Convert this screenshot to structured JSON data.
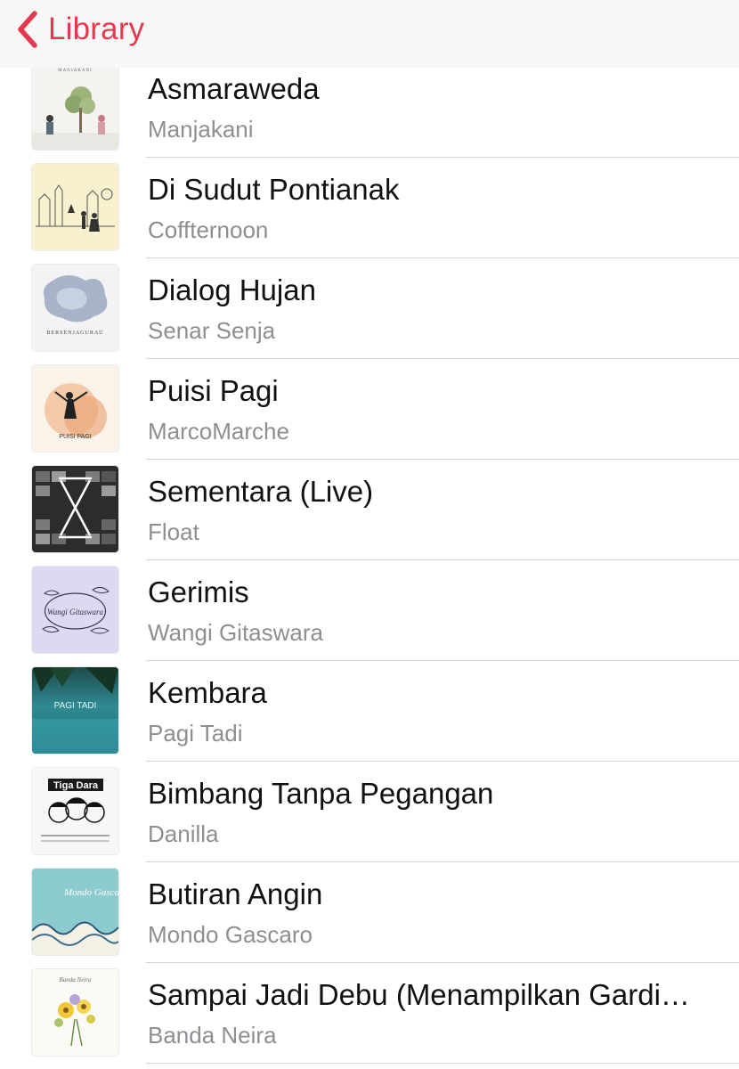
{
  "colors": {
    "accent": "#e33a50",
    "title_text": "#111111",
    "secondary_text": "#8e8e93",
    "separator": "#d6d6da"
  },
  "navbar": {
    "back_label": "Library",
    "back_icon": "chevron-left-icon"
  },
  "songs": [
    {
      "title": "Asmaraweda",
      "artist": "Manjakani",
      "art_text": "MANJAKANI"
    },
    {
      "title": "Di Sudut Pontianak",
      "artist": "Coffternoon",
      "art_text": ""
    },
    {
      "title": "Dialog Hujan",
      "artist": "Senar Senja",
      "art_text": "BERSENJAGURAU"
    },
    {
      "title": "Puisi Pagi",
      "artist": "MarcoMarche",
      "art_text": "PUISI PAGI"
    },
    {
      "title": "Sementara (Live)",
      "artist": "Float",
      "art_text": ""
    },
    {
      "title": "Gerimis",
      "artist": "Wangi Gitaswara",
      "art_text": "Wangi Gitaswara"
    },
    {
      "title": "Kembara",
      "artist": "Pagi Tadi",
      "art_text": "PAGI TADI"
    },
    {
      "title": "Bimbang Tanpa Pegangan",
      "artist": "Danilla",
      "art_text": "Tiga Dara"
    },
    {
      "title": "Butiran Angin",
      "artist": "Mondo Gascaro",
      "art_text": "Mondo Gascaro"
    },
    {
      "title": "Sampai Jadi Debu (Menampilkan Gardi…",
      "artist": "Banda Neira",
      "art_text": "Banda Neira"
    }
  ]
}
